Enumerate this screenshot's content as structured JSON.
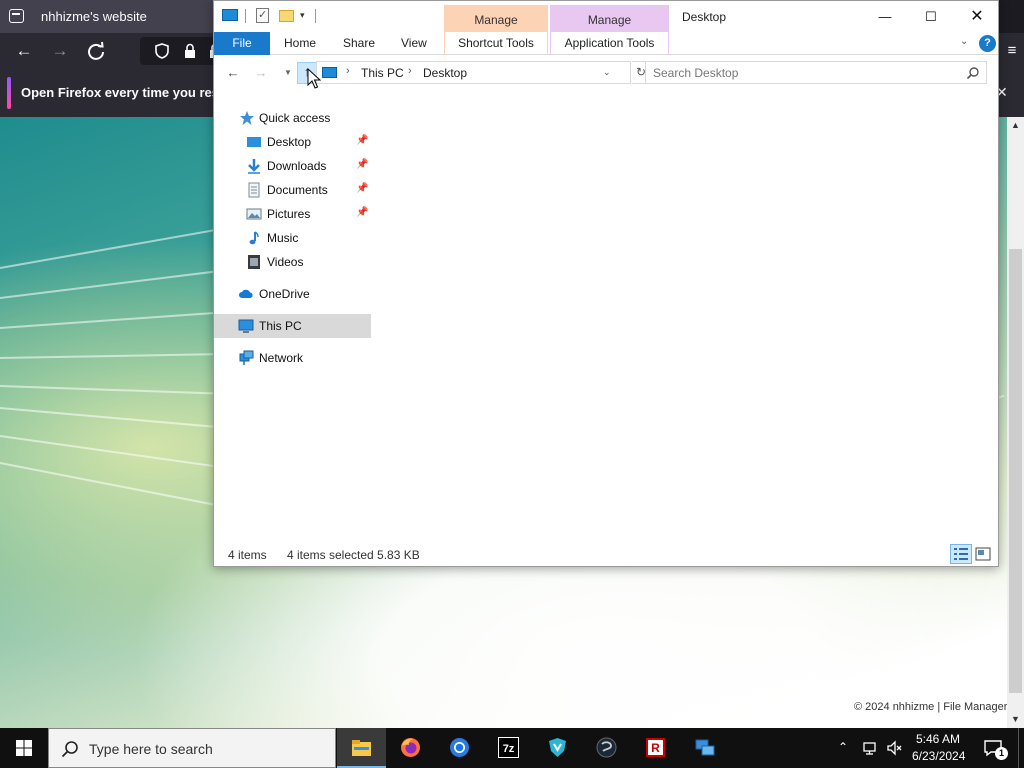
{
  "firefox": {
    "tab_title": "nhhizme's website",
    "notification_text": "Open Firefox every time you restart",
    "footer_text": "© 2024 nhhizme | File Manager"
  },
  "explorer": {
    "window_title": "Desktop",
    "context_tabs": {
      "shortcut_header": "Manage",
      "application_header": "Manage"
    },
    "ribbon_tabs": {
      "file": "File",
      "home": "Home",
      "share": "Share",
      "view": "View",
      "shortcut_tools": "Shortcut Tools",
      "application_tools": "Application Tools"
    },
    "address": {
      "crumb_this_pc": "This PC",
      "crumb_desktop": "Desktop"
    },
    "search": {
      "placeholder": "Search Desktop"
    },
    "nav_pane": {
      "quick_access": "Quick access",
      "quick_items": [
        {
          "label": "Desktop",
          "icon": "desktop-folder-icon",
          "pinned": true
        },
        {
          "label": "Downloads",
          "icon": "downloads-icon",
          "pinned": true
        },
        {
          "label": "Documents",
          "icon": "documents-icon",
          "pinned": true
        },
        {
          "label": "Pictures",
          "icon": "pictures-icon",
          "pinned": true
        },
        {
          "label": "Music",
          "icon": "music-icon",
          "pinned": false
        },
        {
          "label": "Videos",
          "icon": "videos-icon",
          "pinned": false
        }
      ],
      "onedrive": "OneDrive",
      "this_pc": "This PC",
      "network": "Network"
    },
    "status": {
      "item_count": "4 items",
      "selection": "4 items selected  5.83 KB"
    }
  },
  "taskbar": {
    "search_placeholder": "Type here to search",
    "pinned_apps": [
      "file-explorer",
      "firefox",
      "chrome",
      "7-zip",
      "vpn-shield",
      "steam",
      "roblox-studio",
      "network-app"
    ],
    "clock_time": "5:46 AM",
    "clock_date": "6/23/2024",
    "notification_count": "1"
  },
  "colors": {
    "ribbon_file": "#1979ca",
    "shortcut_tools": "#fcd3b5",
    "application_tools": "#e8c7f0",
    "selection": "#cce8ff",
    "taskbar": "#101010"
  }
}
